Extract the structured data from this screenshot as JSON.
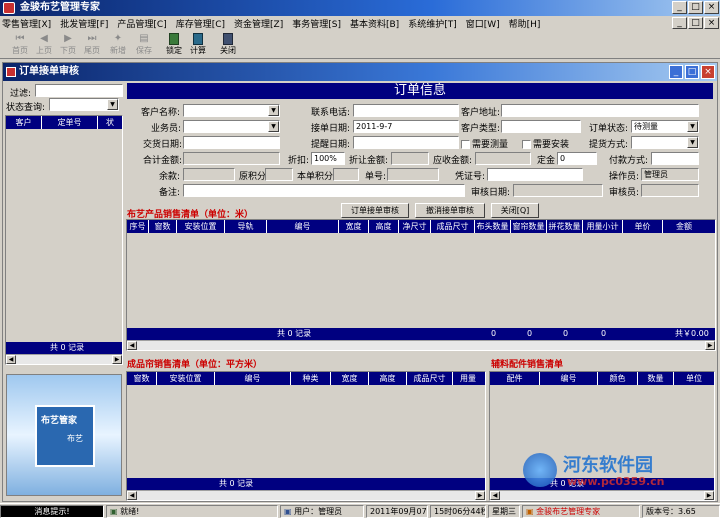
{
  "app": {
    "title": "金骏布艺管理专家"
  },
  "menu": [
    "零售管理[X]",
    "批发管理[F]",
    "产品管理[C]",
    "库存管理[C]",
    "资金管理[Z]",
    "事务管理[S]",
    "基本资料[B]",
    "系统维护[T]",
    "窗口[W]",
    "帮助[H]"
  ],
  "toolbar": {
    "first": "首页",
    "prev": "上页",
    "next": "下页",
    "last": "尾页",
    "new": "新增",
    "save": "保存",
    "lock": "锁定",
    "calc": "计算",
    "close": "关闭"
  },
  "child": {
    "title": "订单接单审核"
  },
  "left": {
    "filter_label": "过滤:",
    "status_label": "状态查询:",
    "col_customer": "客户",
    "col_order": "定单号",
    "col_state": "状",
    "footer": "共 0 记录"
  },
  "form": {
    "heading": "订单信息",
    "customer_name": "客户名称:",
    "contact_phone": "联系电话:",
    "customer_address": "客户地址:",
    "salesman": "业务员:",
    "order_date": "接单日期:",
    "order_date_val": "2011-9-7",
    "customer_type": "客户类型:",
    "order_state": "订单状态:",
    "order_state_val": "待测量",
    "delivery_date": "交货日期:",
    "remind_date": "提醒日期:",
    "need_measure": "需要测量",
    "need_install": "需要安装",
    "pickup": "提货方式:",
    "total": "合计金额:",
    "discount": "折扣:",
    "discount_val": "100%",
    "discounted": "折让金额:",
    "receivable": "应收金额:",
    "deposit": "定金",
    "deposit_val": "0",
    "pay": "付款方式:",
    "balance": "余款:",
    "orig_points": "原积分",
    "this_points": "本单积分",
    "bill_no": "单号:",
    "voucher": "凭证号:",
    "operator": "操作员:",
    "operator_val": "管理员",
    "remark": "备注:",
    "audit_date": "审核日期:",
    "auditor": "审核员:"
  },
  "buttons": {
    "audit": "订单接单审核",
    "cancel_audit": "撤消接单审核",
    "close": "关闭[Q]"
  },
  "prod": {
    "title": "布艺产品销售清单（单位：米）",
    "cols": [
      "序号",
      "窗数",
      "安装位置",
      "导轨",
      "编号",
      "宽度",
      "高度",
      "净尺寸",
      "成品尺寸",
      "布头数量",
      "窗帘数量",
      "拼花数量",
      "用量小计",
      "单价",
      "金额"
    ],
    "footer": "共 0 记录",
    "f1": "0",
    "f2": "0",
    "f3": "0",
    "f4": "0",
    "f5": "共￥0.00"
  },
  "curtain": {
    "title": "成品帘销售清单（单位：平方米）",
    "cols": [
      "窗数",
      "安装位置",
      "编号",
      "种类",
      "宽度",
      "高度",
      "成品尺寸",
      "用量"
    ],
    "footer": "共 0 记录"
  },
  "acc": {
    "title": "辅料配件销售清单",
    "cols": [
      "配件",
      "编号",
      "颜色",
      "数量",
      "单位"
    ],
    "footer": "共 0 记录"
  },
  "image": {
    "text1": "布艺管家",
    "text2": "布艺"
  },
  "status": {
    "hint": "消息提示!",
    "ready": "就绪!",
    "user": "用户：管理员",
    "datetime": "2011年09月07日",
    "time": "15时06分44秒",
    "weekday": "星期三",
    "product": "金骏布艺管理专家",
    "version": "版本号：3.65"
  },
  "watermark": {
    "name": "河东软件园",
    "url": "www.pc0359.cn"
  },
  "colors": {
    "grid_header": "#000080",
    "section_title": "#cc0000",
    "window_title": "#0a246a"
  }
}
